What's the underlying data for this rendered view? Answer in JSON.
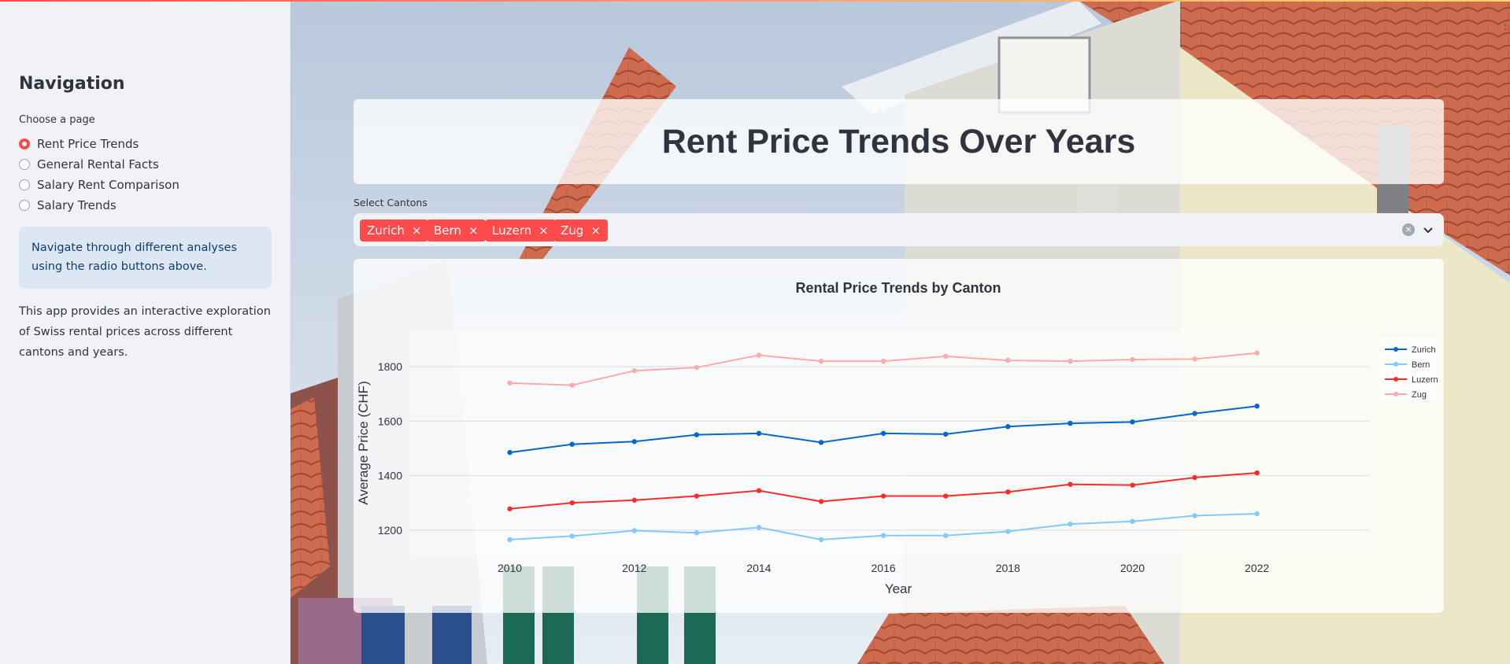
{
  "sidebar": {
    "title": "Navigation",
    "radio_caption": "Choose a page",
    "items": [
      {
        "label": "Rent Price Trends",
        "selected": true
      },
      {
        "label": "General Rental Facts",
        "selected": false
      },
      {
        "label": "Salary Rent Comparison",
        "selected": false
      },
      {
        "label": "Salary Trends",
        "selected": false
      }
    ],
    "info": "Navigate through different analyses using the radio buttons above.",
    "about": "This app provides an interactive exploration of Swiss rental prices across different cantons and years."
  },
  "main": {
    "title": "Rent Price Trends Over Years",
    "select_label": "Select Cantons",
    "selected_cantons": [
      "Zurich",
      "Bern",
      "Luzern",
      "Zug"
    ],
    "remove_glyph": "×",
    "clear_glyph": "×",
    "menu_glyph": "⋮"
  },
  "colors": {
    "accent": "#ff4b4b",
    "zurich": "#0068c9",
    "bern": "#83c9ff",
    "luzern": "#ff2b2b",
    "zug": "#ffabab"
  },
  "chart_data": {
    "type": "line",
    "title": "Rental Price Trends by Canton",
    "xlabel": "Year",
    "ylabel": "Average Price (CHF)",
    "x": [
      2010,
      2011,
      2012,
      2013,
      2014,
      2015,
      2016,
      2017,
      2018,
      2019,
      2020,
      2021,
      2022
    ],
    "xticks": [
      2010,
      2012,
      2014,
      2016,
      2018,
      2020,
      2022
    ],
    "yticks": [
      1200,
      1400,
      1600,
      1800
    ],
    "xlim": [
      2008.4,
      2023.8
    ],
    "ylim": [
      1107,
      1933
    ],
    "grid": true,
    "legend_position": "top-right",
    "series": [
      {
        "name": "Zurich",
        "color": "#0068c9",
        "values": [
          1485,
          1515,
          1525,
          1550,
          1555,
          1522,
          1555,
          1552,
          1580,
          1592,
          1597,
          1628,
          1655
        ]
      },
      {
        "name": "Bern",
        "color": "#83c9ff",
        "values": [
          1165,
          1178,
          1198,
          1190,
          1210,
          1165,
          1180,
          1180,
          1195,
          1222,
          1232,
          1253,
          1260
        ]
      },
      {
        "name": "Luzern",
        "color": "#ff2b2b",
        "values": [
          1278,
          1300,
          1310,
          1325,
          1345,
          1305,
          1325,
          1325,
          1340,
          1368,
          1365,
          1393,
          1410
        ]
      },
      {
        "name": "Zug",
        "color": "#ffabab",
        "values": [
          1740,
          1732,
          1785,
          1797,
          1842,
          1820,
          1820,
          1838,
          1823,
          1820,
          1826,
          1828,
          1850
        ]
      }
    ]
  }
}
